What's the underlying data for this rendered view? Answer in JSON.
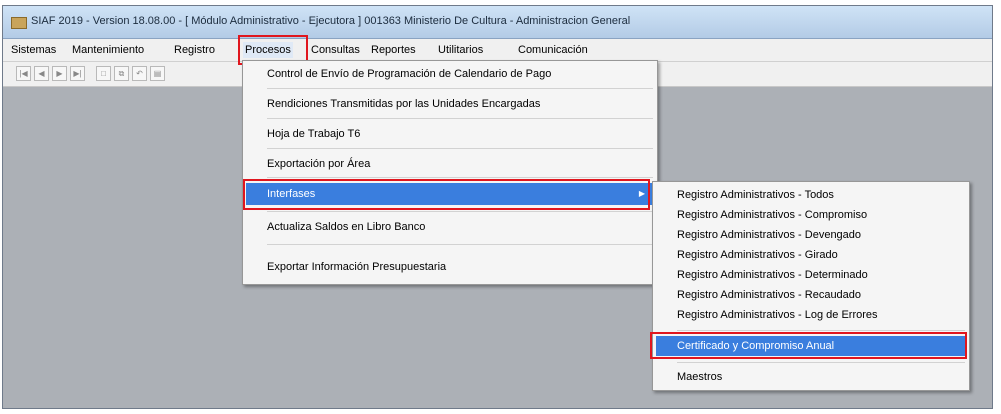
{
  "window": {
    "title": "SIAF 2019 - Version 18.08.00 - [ Módulo Administrativo - Ejecutora ] 001363 Ministerio De Cultura - Administracion General"
  },
  "menubar": {
    "items": [
      "Sistemas",
      "Mantenimiento",
      "Registro",
      "Procesos",
      "Consultas",
      "Reportes",
      "Utilitarios",
      "Comunicación"
    ]
  },
  "toolbar": {
    "icons": [
      "first-record-icon",
      "previous-record-icon",
      "next-record-icon",
      "last-record-icon",
      "new-record-icon",
      "copy-record-icon",
      "undo-icon",
      "print-icon"
    ]
  },
  "procesos_menu": {
    "items": [
      "Control de Envío de Programación de Calendario de Pago",
      "Rendiciones Transmitidas por las Unidades Encargadas",
      "Hoja de Trabajo T6",
      "Exportación por Área",
      "Interfases",
      "Actualiza Saldos en Libro Banco",
      "Exportar Información Presupuestaria"
    ]
  },
  "interfases_submenu": {
    "items": [
      "Registro Administrativos - Todos",
      "Registro Administrativos - Compromiso",
      "Registro Administrativos - Devengado",
      "Registro Administrativos - Girado",
      "Registro Administrativos - Determinado",
      "Registro Administrativos - Recaudado",
      "Registro Administrativos - Log de Errores",
      "Certificado y Compromiso Anual",
      "Maestros"
    ]
  },
  "colors": {
    "highlight": "#3a7ede",
    "annotation_box": "#e0161e"
  }
}
